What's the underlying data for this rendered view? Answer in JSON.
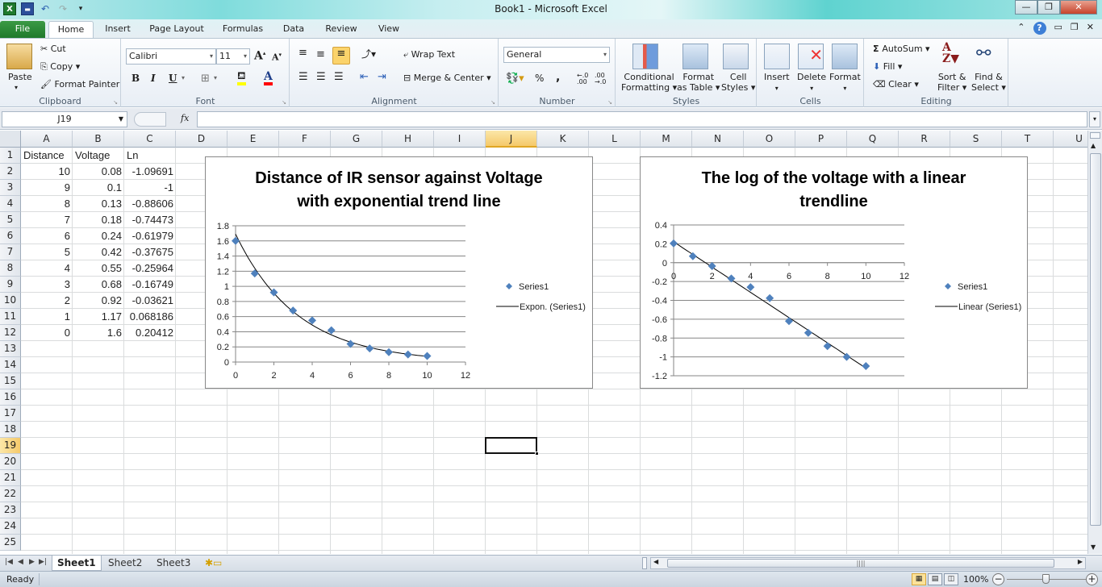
{
  "window": {
    "title": "Book1  -  Microsoft Excel",
    "controls": {
      "minimize": "—",
      "restore": "❐",
      "close": "✕"
    }
  },
  "quick_access": {
    "icons": [
      "excel-logo-icon",
      "save-icon",
      "undo-icon",
      "redo-icon",
      "customize-icon"
    ]
  },
  "ribbon_tabs": [
    {
      "label": "File",
      "active": false
    },
    {
      "label": "Home",
      "active": true
    },
    {
      "label": "Insert",
      "active": false
    },
    {
      "label": "Page Layout",
      "active": false
    },
    {
      "label": "Formulas",
      "active": false
    },
    {
      "label": "Data",
      "active": false
    },
    {
      "label": "Review",
      "active": false
    },
    {
      "label": "View",
      "active": false
    }
  ],
  "ribbon": {
    "clipboard": {
      "label": "Clipboard",
      "paste": "Paste",
      "cut": "Cut",
      "copy": "Copy",
      "format_painter": "Format Painter"
    },
    "font": {
      "label": "Font",
      "font_name": "Calibri",
      "font_size": "11",
      "bold": "B",
      "italic": "I",
      "underline": "U",
      "grow": "A",
      "shrink": "A",
      "highlight_color": "#ffff00",
      "font_color": "#ff0000"
    },
    "alignment": {
      "label": "Alignment",
      "wrap_text": "Wrap Text",
      "merge_center": "Merge & Center"
    },
    "number": {
      "label": "Number",
      "format": "General",
      "percent": "%",
      "comma": ",",
      "inc_decimal": "←.0 .00",
      "dec_decimal": ".00 →.0"
    },
    "styles": {
      "label": "Styles",
      "conditional_formatting": [
        "Conditional",
        "Formatting ▾"
      ],
      "format_as_table": [
        "Format",
        "as Table ▾"
      ],
      "cell_styles": [
        "Cell",
        "Styles ▾"
      ]
    },
    "cells": {
      "label": "Cells",
      "insert": "Insert",
      "delete": "Delete",
      "format": "Format"
    },
    "editing": {
      "label": "Editing",
      "autosum": "AutoSum",
      "fill": "Fill",
      "clear": "Clear",
      "sort_filter": [
        "Sort &",
        "Filter ▾"
      ],
      "find_select": [
        "Find &",
        "Select ▾"
      ]
    }
  },
  "formula_bar": {
    "name_box": "J19",
    "fx": "fx",
    "formula": ""
  },
  "columns": [
    "A",
    "B",
    "C",
    "D",
    "E",
    "F",
    "G",
    "H",
    "I",
    "J",
    "K",
    "L",
    "M",
    "N",
    "O",
    "P",
    "Q",
    "R",
    "S",
    "T",
    "U"
  ],
  "selected_column": "J",
  "rows": [
    "1",
    "2",
    "3",
    "4",
    "5",
    "6",
    "7",
    "8",
    "9",
    "10",
    "11",
    "12",
    "13",
    "14",
    "15",
    "16",
    "17",
    "18",
    "19",
    "20",
    "21",
    "22",
    "23",
    "24",
    "25"
  ],
  "selected_row": "19",
  "table": {
    "headers": [
      "Distance",
      "Voltage",
      "Ln"
    ],
    "rows": [
      [
        "10",
        "0.08",
        "-1.09691"
      ],
      [
        "9",
        "0.1",
        "-1"
      ],
      [
        "8",
        "0.13",
        "-0.88606"
      ],
      [
        "7",
        "0.18",
        "-0.74473"
      ],
      [
        "6",
        "0.24",
        "-0.61979"
      ],
      [
        "5",
        "0.42",
        "-0.37675"
      ],
      [
        "4",
        "0.55",
        "-0.25964"
      ],
      [
        "3",
        "0.68",
        "-0.16749"
      ],
      [
        "2",
        "0.92",
        "-0.03621"
      ],
      [
        "1",
        "1.17",
        "0.068186"
      ],
      [
        "0",
        "1.6",
        "0.20412"
      ]
    ]
  },
  "chart_data": [
    {
      "type": "scatter",
      "title_lines": [
        "Distance of IR sensor against Voltage",
        "with exponential trend line"
      ],
      "x": [
        10,
        9,
        8,
        7,
        6,
        5,
        4,
        3,
        2,
        1,
        0
      ],
      "series": [
        {
          "name": "Series1",
          "values": [
            0.08,
            0.1,
            0.13,
            0.18,
            0.24,
            0.42,
            0.55,
            0.68,
            0.92,
            1.17,
            1.6
          ],
          "color": "#4f81bd",
          "marker": "diamond"
        }
      ],
      "trendline": {
        "name": "Expon. (Series1)",
        "kind": "exponential",
        "a": 1.69,
        "b": -0.31,
        "color": "#000000"
      },
      "xlim": [
        0,
        12
      ],
      "xticks": [
        "0",
        "2",
        "4",
        "6",
        "8",
        "10",
        "12"
      ],
      "ylim": [
        0,
        1.8
      ],
      "yticks": [
        "0",
        "0.2",
        "0.4",
        "0.6",
        "0.8",
        "1",
        "1.2",
        "1.4",
        "1.6",
        "1.8"
      ],
      "grid": true,
      "legend": "right",
      "legend_entries": [
        "Series1",
        "Expon. (Series1)"
      ]
    },
    {
      "type": "scatter",
      "title_lines": [
        "The log of the voltage with a linear",
        "trendline"
      ],
      "x": [
        10,
        9,
        8,
        7,
        6,
        5,
        4,
        3,
        2,
        1,
        0
      ],
      "series": [
        {
          "name": "Series1",
          "values": [
            -1.09691,
            -1,
            -0.88606,
            -0.74473,
            -0.61979,
            -0.37675,
            -0.25964,
            -0.16749,
            -0.03621,
            0.068186,
            0.20412
          ],
          "color": "#4f81bd",
          "marker": "diamond"
        }
      ],
      "trendline": {
        "name": "Linear (Series1)",
        "kind": "linear",
        "slope": -0.134,
        "intercept": 0.221,
        "color": "#000000"
      },
      "xlim": [
        0,
        12
      ],
      "xticks": [
        "0",
        "2",
        "4",
        "6",
        "8",
        "10",
        "12"
      ],
      "ylim": [
        -1.2,
        0.4
      ],
      "yticks": [
        "-1.2",
        "-1",
        "-0.8",
        "-0.6",
        "-0.4",
        "-0.2",
        "0",
        "0.2",
        "0.4"
      ],
      "grid": true,
      "legend": "right",
      "legend_entries": [
        "Series1",
        "Linear (Series1)"
      ]
    }
  ],
  "sheets": [
    {
      "label": "Sheet1",
      "active": true
    },
    {
      "label": "Sheet2",
      "active": false
    },
    {
      "label": "Sheet3",
      "active": false
    }
  ],
  "status": {
    "ready": "Ready",
    "zoom": "100%",
    "zoom_fraction": 0.5
  }
}
